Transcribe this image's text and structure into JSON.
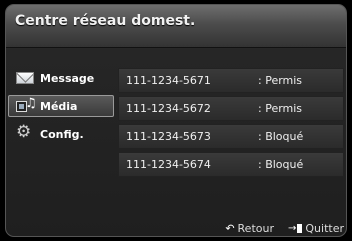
{
  "title": "Centre réseau domest.",
  "sidebar": {
    "items": [
      {
        "label": "Message",
        "icon": "envelope-icon",
        "selected": false
      },
      {
        "label": "Média",
        "icon": "media-icon",
        "selected": true
      },
      {
        "label": "Config.",
        "icon": "gear-icon",
        "selected": false
      }
    ]
  },
  "list": {
    "rows": [
      {
        "number": "111-1234-5671",
        "status": ": Permis"
      },
      {
        "number": "111-1234-5672",
        "status": ": Permis"
      },
      {
        "number": "111-1234-5673",
        "status": ": Bloqué"
      },
      {
        "number": "111-1234-5674",
        "status": ": Bloqué"
      }
    ]
  },
  "footer": {
    "return_label": "Retour",
    "return_icon": "return-icon",
    "exit_label": "Quitter",
    "exit_icon": "exit-icon"
  },
  "colors": {
    "background": "#000000",
    "panel": "#262626",
    "title_bar": "#4c4c4c",
    "row": "#333333",
    "text": "#ffffff"
  }
}
